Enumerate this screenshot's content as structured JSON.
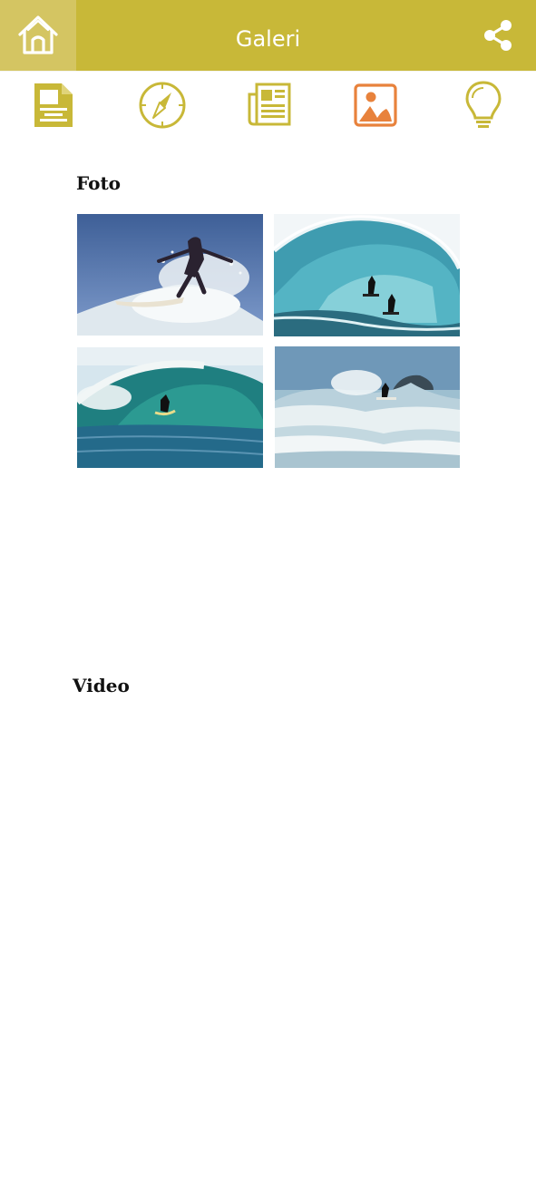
{
  "header": {
    "title": "Galeri",
    "home_icon": "home-icon",
    "share_icon": "share-icon"
  },
  "nav": {
    "items": [
      {
        "icon": "document-icon"
      },
      {
        "icon": "compass-icon"
      },
      {
        "icon": "newspaper-icon"
      },
      {
        "icon": "gallery-icon",
        "active": true
      },
      {
        "icon": "lightbulb-icon"
      }
    ]
  },
  "sections": {
    "photo_title": "Foto",
    "video_title": "Video"
  },
  "colors": {
    "primary": "#c8b838",
    "home_bg": "#d4c562",
    "active_icon": "#e8823c"
  }
}
